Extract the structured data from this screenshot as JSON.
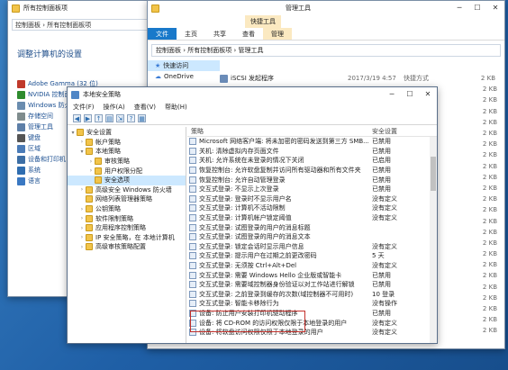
{
  "control_panel": {
    "title": "所有控制面板项",
    "address": "控制面板 › 所有控制面板项",
    "heading": "调整计算机的设置",
    "items": [
      "Adobe Gamma (32 位)",
      "NVIDIA 控制面板",
      "Windows 防火",
      "存储空间",
      "管理工具",
      "键盘",
      "区域",
      "设备和打印机",
      "系统",
      "语言"
    ]
  },
  "explorer": {
    "ribbon_context": "快捷工具",
    "window_title": "管理工具",
    "tabs": [
      "文件",
      "主页",
      "共享",
      "查看",
      "管理"
    ],
    "address": "控制面板 › 所有控制面板项 › 管理工具",
    "nav": [
      "快速访问",
      "OneDrive"
    ],
    "first_item": {
      "name": "iSCSI 发起程序",
      "date": "2017/3/19 4:57",
      "type": "快捷方式",
      "size": "2 KB"
    },
    "sizes": [
      "2 KB",
      "2 KB",
      "2 KB",
      "2 KB",
      "2 KB",
      "2 KB",
      "2 KB",
      "2 KB",
      "2 KB",
      "2 KB",
      "2 KB",
      "2 KB",
      "2 KB",
      "2 KB",
      "2 KB",
      "2 KB",
      "2 KB",
      "2 KB",
      "2 KB",
      "2 KB",
      "2 KB",
      "2 KB",
      "2 KB"
    ]
  },
  "policy": {
    "title": "本地安全策略",
    "menu": [
      "文件(F)",
      "操作(A)",
      "查看(V)",
      "帮助(H)"
    ],
    "tree": [
      {
        "label": "安全设置",
        "depth": 0,
        "arrow": "▾"
      },
      {
        "label": "帐户策略",
        "depth": 1,
        "arrow": "›"
      },
      {
        "label": "本地策略",
        "depth": 1,
        "arrow": "▾"
      },
      {
        "label": "审核策略",
        "depth": 2,
        "arrow": "›"
      },
      {
        "label": "用户权限分配",
        "depth": 2,
        "arrow": "›"
      },
      {
        "label": "安全选项",
        "depth": 2,
        "arrow": "",
        "selected": true
      },
      {
        "label": "高级安全 Windows 防火墙",
        "depth": 1,
        "arrow": "›"
      },
      {
        "label": "网络列表管理器策略",
        "depth": 1,
        "arrow": ""
      },
      {
        "label": "公钥策略",
        "depth": 1,
        "arrow": "›"
      },
      {
        "label": "软件限制策略",
        "depth": 1,
        "arrow": "›"
      },
      {
        "label": "应用程序控制策略",
        "depth": 1,
        "arrow": "›"
      },
      {
        "label": "IP 安全策略，在 本地计算机",
        "depth": 1,
        "arrow": "›"
      },
      {
        "label": "高级审核策略配置",
        "depth": 1,
        "arrow": "›"
      }
    ],
    "columns": {
      "policy": "策略",
      "setting": "安全设置"
    },
    "rows": [
      {
        "name": "Microsoft 网络客户端: 将未加密的密码发送到第三方 SMB...",
        "setting": "已禁用"
      },
      {
        "name": "关机: 清除虚拟内存页面文件",
        "setting": "已禁用"
      },
      {
        "name": "关机: 允许系统在未登录的情况下关闭",
        "setting": "已启用"
      },
      {
        "name": "恢复控制台: 允许软盘复制并访问所有驱动器和所有文件夹",
        "setting": "已禁用"
      },
      {
        "name": "恢复控制台: 允许自动管理登录",
        "setting": "已禁用"
      },
      {
        "name": "交互式登录: 不显示上次登录",
        "setting": "已禁用"
      },
      {
        "name": "交互式登录: 登录时不显示用户名",
        "setting": "没有定义"
      },
      {
        "name": "交互式登录: 计算机不活动限制",
        "setting": "没有定义"
      },
      {
        "name": "交互式登录: 计算机帐户锁定阈值",
        "setting": "没有定义"
      },
      {
        "name": "交互式登录: 试图登录的用户的消息标题",
        "setting": ""
      },
      {
        "name": "交互式登录: 试图登录的用户的消息文本",
        "setting": ""
      },
      {
        "name": "交互式登录: 锁定会话时显示用户信息",
        "setting": "没有定义"
      },
      {
        "name": "交互式登录: 提示用户在过期之前更改密码",
        "setting": "5 天"
      },
      {
        "name": "交互式登录: 无须按 Ctrl+Alt+Del",
        "setting": "没有定义"
      },
      {
        "name": "交互式登录: 需要 Windows Hello 企业版或智能卡",
        "setting": "已禁用"
      },
      {
        "name": "交互式登录: 需要域控制器身份验证以对工作站进行解锁",
        "setting": "已禁用"
      },
      {
        "name": "交互式登录: 之前登录到缓存的次数(域控制器不可用时)",
        "setting": "10 登录"
      },
      {
        "name": "交互式登录: 智能卡移除行为",
        "setting": "没有操作"
      },
      {
        "name": "设备: 防止用户安装打印机驱动程序",
        "setting": "已禁用"
      },
      {
        "name": "设备: 将 CD-ROM 的访问权限仅限于本地登录的用户",
        "setting": "没有定义"
      },
      {
        "name": "设备: 将软盘访问权限仅限于本地登录的用户",
        "setting": "没有定义"
      }
    ]
  }
}
